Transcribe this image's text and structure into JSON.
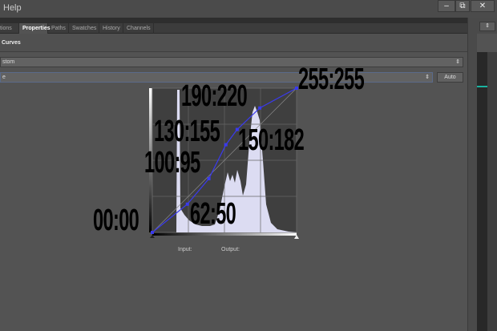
{
  "menu": {
    "help": "Help"
  },
  "window_buttons": {
    "minimize": "–",
    "restore": "⧉",
    "close": "✕"
  },
  "tabs": [
    {
      "label": "tions",
      "active": false
    },
    {
      "label": "Properties",
      "active": true
    },
    {
      "label": "Paths",
      "active": false
    },
    {
      "label": "Swatches",
      "active": false
    },
    {
      "label": "History",
      "active": false
    },
    {
      "label": "Channels",
      "active": false
    }
  ],
  "panel": {
    "title": "Curves",
    "preset": "stom",
    "channel": "e",
    "auto_label": "Auto",
    "input_label": "Input:",
    "output_label": "Output:"
  },
  "curve": {
    "points": [
      [
        0,
        0
      ],
      [
        62,
        50
      ],
      [
        100,
        95
      ],
      [
        130,
        155
      ],
      [
        150,
        182
      ],
      [
        190,
        220
      ],
      [
        255,
        255
      ]
    ],
    "color": "#3a3aee"
  },
  "annotations": [
    "00:00",
    "62:50",
    "100:95",
    "130:155",
    "150:182",
    "190:220",
    "255:255"
  ],
  "colors": {
    "accent": "#1ab3a0",
    "histogram": "#dcdcf2"
  }
}
